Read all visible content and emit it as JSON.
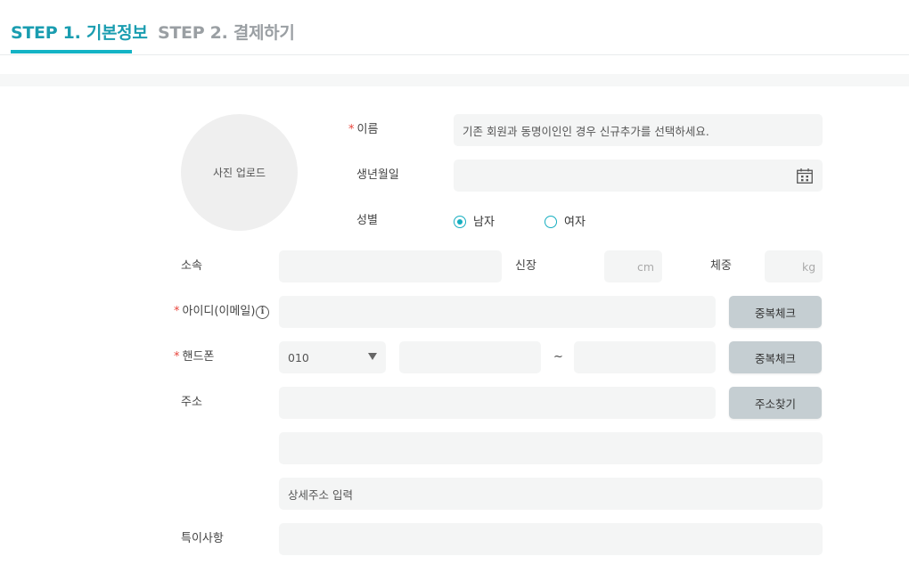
{
  "tabs": {
    "step1": "STEP 1. 기본정보",
    "step2": "STEP 2. 결제하기"
  },
  "photo": {
    "label": "사진 업로드"
  },
  "required_mark": "*",
  "fields": {
    "name": {
      "label": "이름",
      "placeholder": "기존 회원과 동명이인인 경우 신규추가를 선택하세요."
    },
    "birthdate": {
      "label": "생년월일",
      "icon": "calendar-icon"
    },
    "gender": {
      "label": "성별",
      "options": [
        "남자",
        "여자"
      ],
      "selected": "남자"
    },
    "affiliation": {
      "label": "소속"
    },
    "height": {
      "label": "신장",
      "unit": "cm"
    },
    "weight": {
      "label": "체중",
      "unit": "kg"
    },
    "userid": {
      "label": "아이디(이메일)",
      "info_icon": "info-icon",
      "info_glyph": "i",
      "button": "중복체크"
    },
    "phone": {
      "label": "핸드폰",
      "prefix": "010",
      "separator": "~",
      "button": "중복체크"
    },
    "address": {
      "label": "주소",
      "button": "주소찾기",
      "detail_placeholder": "상세주소 입력"
    },
    "notes": {
      "label": "특이사항"
    }
  },
  "colors": {
    "accent": "#14b3c5",
    "required": "#e8453c",
    "input_bg": "#f4f5f5",
    "button_bg": "#c5ced2"
  }
}
